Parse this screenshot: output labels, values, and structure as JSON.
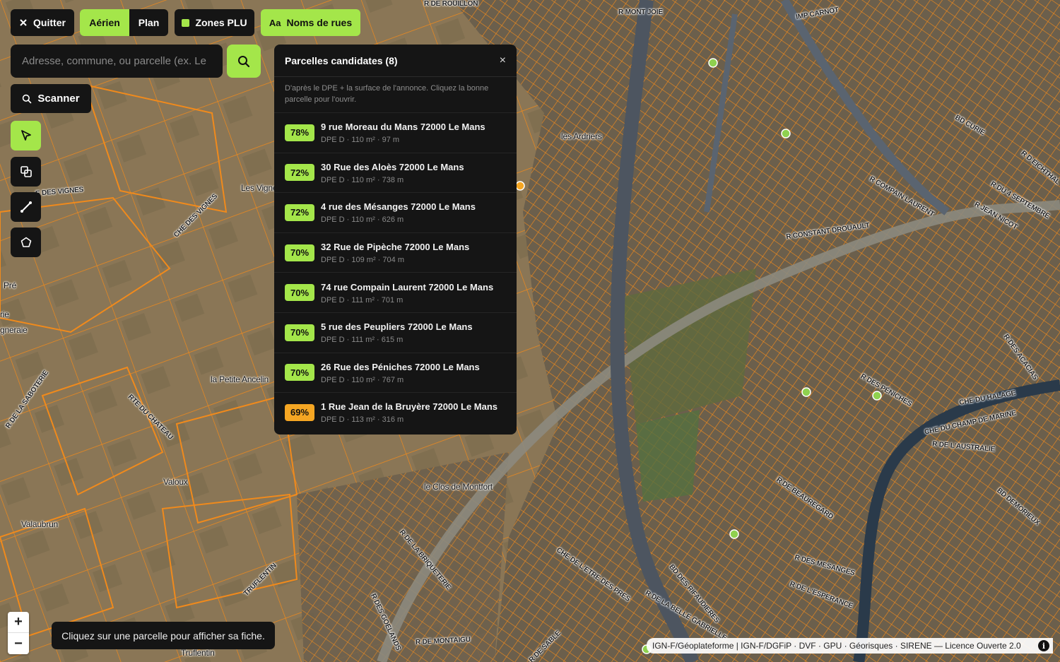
{
  "topbar": {
    "quit_label": "Quitter",
    "view_tabs": [
      "Aérien",
      "Plan"
    ],
    "active_view": "Aérien",
    "zones_label": "Zones PLU",
    "streets_icon_text": "Aa",
    "streets_label": "Noms de rues"
  },
  "search": {
    "placeholder": "Adresse, commune, ou parcelle (ex. Le",
    "button_icon": "search-icon"
  },
  "scan": {
    "label": "Scanner",
    "icon": "search-icon"
  },
  "tools": [
    {
      "name": "select-tool",
      "icon": "cursor-icon",
      "active": true
    },
    {
      "name": "layers-tool",
      "icon": "copy-icon",
      "active": false
    },
    {
      "name": "measure-line-tool",
      "icon": "line-icon",
      "active": false
    },
    {
      "name": "polygon-tool",
      "icon": "pentagon-icon",
      "active": false
    }
  ],
  "panel": {
    "title": "Parcelles candidates (8)",
    "close": "×",
    "description": "D'après le DPE + la surface de l'annonce. Cliquez la bonne parcelle pour l'ouvrir.",
    "items": [
      {
        "score": "78%",
        "address": "9 rue Moreau du Mans 72000 Le Mans",
        "meta": "DPE D · 110 m² · 97 m",
        "color": "#a4e64a"
      },
      {
        "score": "72%",
        "address": "30 Rue des Aloès 72000 Le Mans",
        "meta": "DPE D · 110 m² · 738 m",
        "color": "#a4e64a"
      },
      {
        "score": "72%",
        "address": "4 rue des Mésanges 72000 Le Mans",
        "meta": "DPE D · 110 m² · 626 m",
        "color": "#a4e64a"
      },
      {
        "score": "70%",
        "address": "32 Rue de Pipèche 72000 Le Mans",
        "meta": "DPE D · 109 m² · 704 m",
        "color": "#a4e64a"
      },
      {
        "score": "70%",
        "address": "74 rue Compain Laurent 72000 Le Mans",
        "meta": "DPE D · 111 m² · 701 m",
        "color": "#a4e64a"
      },
      {
        "score": "70%",
        "address": "5 rue des Peupliers 72000 Le Mans",
        "meta": "DPE D · 111 m² · 615 m",
        "color": "#a4e64a"
      },
      {
        "score": "70%",
        "address": "26 Rue des Péniches 72000 Le Mans",
        "meta": "DPE D · 110 m² · 767 m",
        "color": "#a4e64a"
      },
      {
        "score": "69%",
        "address": "1 Rue Jean de la Bruyère 72000 Le Mans",
        "meta": "DPE D · 113 m² · 316 m",
        "color": "#f5a623"
      }
    ]
  },
  "map": {
    "parcel_color": "#f08a1c",
    "marker_color": "#8fd14f",
    "labels": {
      "les_ardriers": "les Ardriers",
      "les_vignes": "Les Vigne",
      "pre": "Pré",
      "rie": "rie",
      "gneraie": "gneraie",
      "petite_ancelin": "la Petite Ancelin",
      "valoux": "Valoux",
      "valaubrun": "Valaubrun",
      "clos_montfort": "le Clos de Montfort",
      "truflentin": "Truflentin",
      "r_rouillon": "R DE ROUILLON",
      "r_mont_joie": "R MONT JOIE",
      "imp_carnot": "IMP CARNOT",
      "bd_curie": "BD CURIE",
      "r_constant_drouault": "R CONSTANT DROUAULT",
      "r_compain_laurent": "R COMPAIN LAURENT",
      "r_jean_nicot": "R JEAN NICOT",
      "r_4_septembre": "R DU 4 SEPTEMBRE",
      "r_eichthal": "R D EICHTHAL",
      "che_halage": "CHE DU HALAGE",
      "che_champ_marine": "CHE DU CHAMP DE MARINE",
      "r_australie": "R DE L'AUSTRALIE",
      "r_des_peniches": "R DES PÉNICHES",
      "r_beauregard": "R DE BEAUREGARD",
      "r_des_mesanges": "R DES MESANGES",
      "r_esperance": "R DE L'ESPERANCE",
      "bd_demorieux": "BD DEMORIEUX",
      "r_de_montaigu": "R DE MONTAIGU",
      "che_vignes": "CHE DES VIGNES",
      "e_des_vignes": "E DES VIGNES",
      "rte_chateau": "RTE DU CHATEAU",
      "r_saboterie": "R DE LA SABOTERIE",
      "truflentin_road": "TRUFLENTIN",
      "r_briqueterie": "R DE LA BRIQUETERIE",
      "r_goelands": "R DES GOELANDS",
      "che_etre_des_pres": "CHE DE L'ETRE DES PRES",
      "r_belle_gabrielle": "R DE LA BELLE GABRIELLE",
      "bd_rifaudieres": "BD DES RIFAUDIERES",
      "r_des_acacias": "R DES ACACIAS",
      "r_de_sable": "R DE SABLE"
    }
  },
  "zoom": {
    "in": "+",
    "out": "−"
  },
  "hint": "Cliquez sur une parcelle pour afficher sa fiche.",
  "attribution": "IGN-F/Géoplateforme | IGN-F/DGFiP · DVF · GPU · Géorisques · SIRENE — Licence Ouverte 2.0",
  "info_icon": "i"
}
